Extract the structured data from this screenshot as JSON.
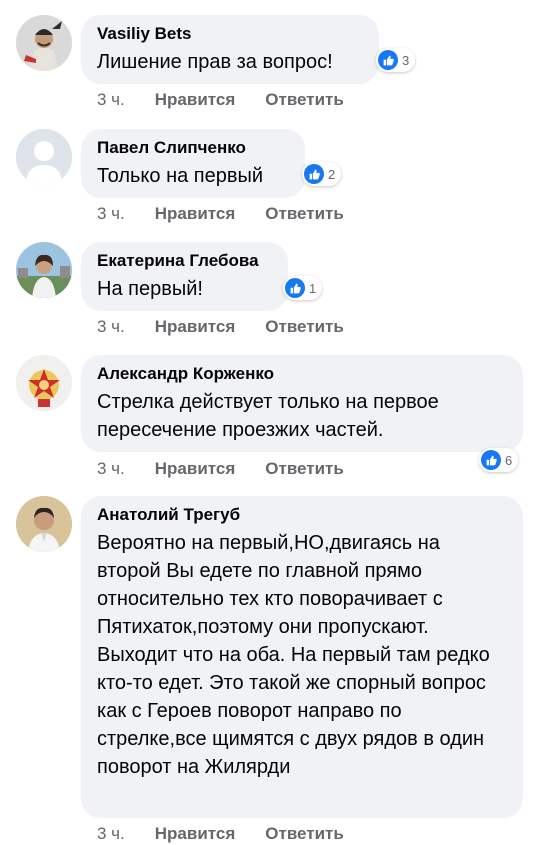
{
  "comments": [
    {
      "author": "Vasiliy Bets",
      "text": "Лишение прав за вопрос!",
      "like_count": "3",
      "time": "3 ч.",
      "like_label": "Нравится",
      "reply_label": "Ответить",
      "avatar_icon": "avatar-photo-cossack"
    },
    {
      "author": "Павел Слипченко",
      "text": "Только на первый",
      "like_count": "2",
      "time": "3 ч.",
      "like_label": "Нравится",
      "reply_label": "Ответить",
      "avatar_icon": "default-avatar-icon"
    },
    {
      "author": "Екатерина Глебова",
      "text": "На первый!",
      "like_count": "1",
      "time": "3 ч.",
      "like_label": "Нравится",
      "reply_label": "Ответить",
      "avatar_icon": "avatar-photo-woman"
    },
    {
      "author": "Александр Корженко",
      "text": "Стрелка действует только на первое пересечение проезжих частей.",
      "like_count": "6",
      "time": "3 ч.",
      "like_label": "Нравится",
      "reply_label": "Ответить",
      "avatar_icon": "avatar-photo-star-badge"
    },
    {
      "author": "Анатолий Трегуб",
      "text": "Вероятно на первый,НО,двигаясь на второй Вы едете по главной прямо относительно тех кто поворачивает с Пятихаток,поэтому они пропускают. Выходит что на оба. На первый там редко кто-то едет. Это такой же спорный вопрос как с Героев поворот направо по стрелке,все щимятся с двух рядов в один поворот на Жилярди",
      "time": "3 ч.",
      "like_label": "Нравится",
      "reply_label": "Ответить",
      "avatar_icon": "avatar-photo-man"
    }
  ],
  "colors": {
    "bubble": "#f0f2f5",
    "like_blue": "#1877f2",
    "secondary_text": "#65676b"
  }
}
